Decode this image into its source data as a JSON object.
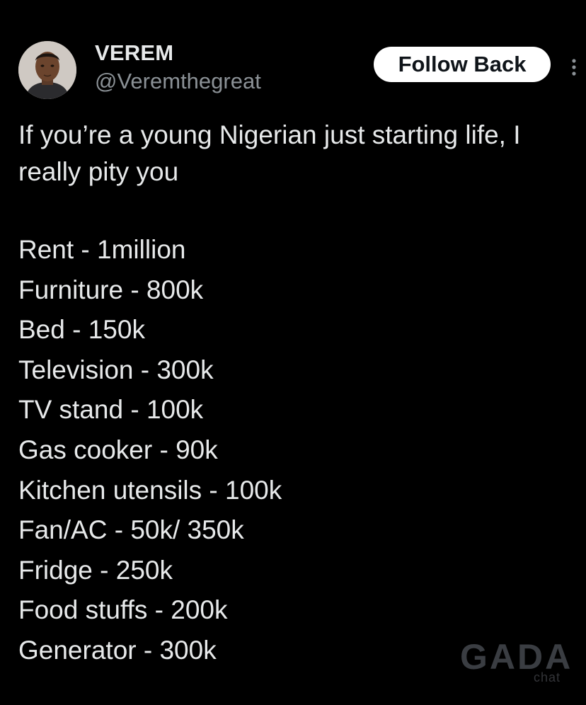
{
  "author": {
    "display_name": "VEREM",
    "handle": "@Veremthegreat",
    "avatar_icon": "user-avatar-photo"
  },
  "actions": {
    "follow_label": "Follow Back",
    "more_icon": "more-vertical-icon"
  },
  "tweet": {
    "intro": "If you’re a young Nigerian just starting life, I really pity you",
    "items": [
      "Rent - 1million",
      "Furniture - 800k",
      "Bed - 150k",
      "Television - 300k",
      "TV stand - 100k",
      "Gas cooker - 90k",
      "Kitchen utensils - 100k",
      "Fan/AC - 50k/ 350k",
      "Fridge - 250k",
      "Food stuffs - 200k",
      "Generator - 300k"
    ]
  },
  "watermark": {
    "main": "GADA",
    "sub": "chat"
  },
  "colors": {
    "background": "#000000",
    "text_primary": "#e7e9ea",
    "text_secondary": "#8b9196",
    "button_bg": "#ffffff",
    "button_text": "#0f1419"
  }
}
